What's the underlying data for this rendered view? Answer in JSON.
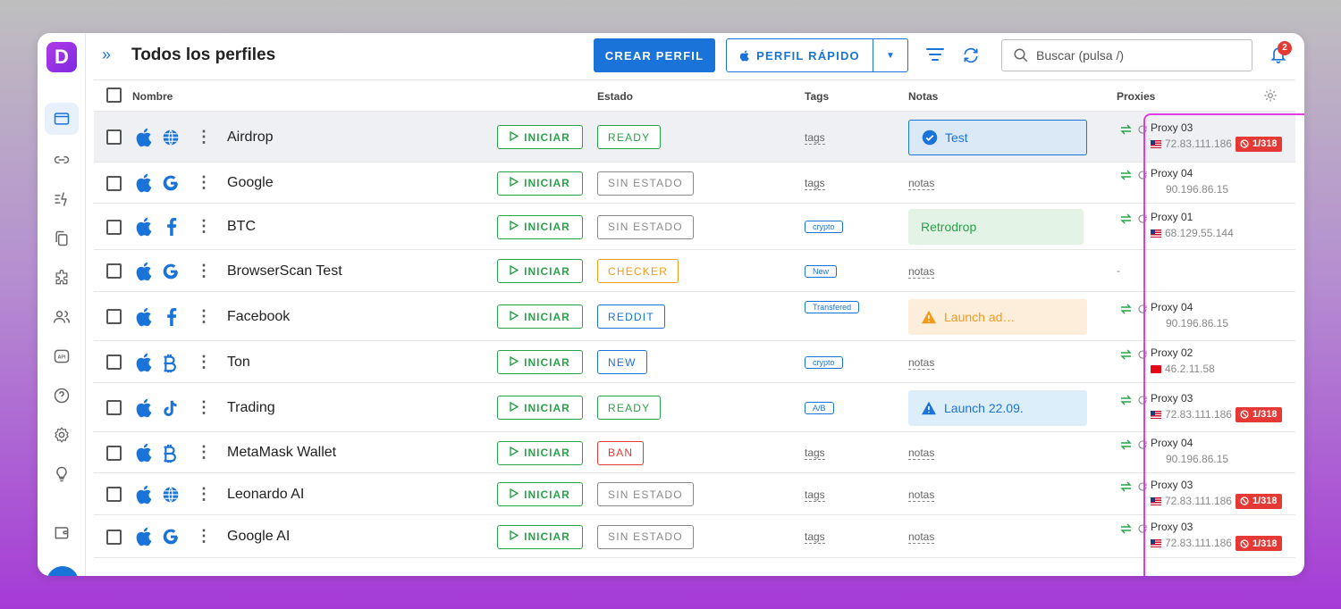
{
  "app": {
    "logo_letter": "D",
    "title": "Todos los perfiles"
  },
  "header": {
    "create_label": "CREAR PERFIL",
    "quick_label": "PERFIL RÁPIDO",
    "search_placeholder": "Buscar (pulsa /)",
    "notification_count": "2"
  },
  "table": {
    "columns": {
      "name": "Nombre",
      "status": "Estado",
      "tags": "Tags",
      "notes": "Notas",
      "proxies": "Proxies"
    },
    "start_label": "INICIAR"
  },
  "profiles": [
    {
      "name": "Airdrop",
      "os_icon": "apple-icon",
      "site_icon": "globe-icon",
      "status": "READY",
      "status_color": "#27a348",
      "tag": "tags",
      "tag_is_placeholder": true,
      "note": "Test",
      "note_kind": "info",
      "proxy": {
        "name": "Proxy 03",
        "country": "us",
        "ip": "72.83.111.186",
        "error": "1/318"
      }
    },
    {
      "name": "Google",
      "os_icon": "apple-icon",
      "site_icon": "google-icon",
      "status": "SIN ESTADO",
      "status_color": "#8a8a8a",
      "tag": "tags",
      "tag_is_placeholder": true,
      "note": "notas",
      "note_kind": "placeholder",
      "proxy": {
        "name": "Proxy 04",
        "country": "",
        "ip": "90.196.86.15",
        "error": ""
      }
    },
    {
      "name": "BTC",
      "os_icon": "apple-icon",
      "site_icon": "facebook-icon",
      "status": "SIN ESTADO",
      "status_color": "#8a8a8a",
      "tag": "crypto",
      "tag_is_placeholder": false,
      "note": "Retrodrop",
      "note_kind": "success",
      "proxy": {
        "name": "Proxy 01",
        "country": "us",
        "ip": "68.129.55.144",
        "error": ""
      }
    },
    {
      "name": "BrowserScan Test",
      "os_icon": "apple-icon",
      "site_icon": "google-icon",
      "status": "CHECKER",
      "status_color": "#f29a1a",
      "tag": "New",
      "tag_is_placeholder": false,
      "note": "notas",
      "note_kind": "placeholder",
      "proxy": {
        "name": "",
        "country": "",
        "ip": "",
        "error": "",
        "empty": "-"
      }
    },
    {
      "name": "Facebook",
      "os_icon": "apple-icon",
      "site_icon": "facebook-icon",
      "status": "REDDIT",
      "status_color": "#1a73d9",
      "tag": "Transfered",
      "tag_is_placeholder": false,
      "note": "Launch ad…",
      "note_kind": "warning",
      "proxy": {
        "name": "Proxy 04",
        "country": "",
        "ip": "90.196.86.15",
        "error": ""
      }
    },
    {
      "name": "Ton",
      "os_icon": "apple-icon",
      "site_icon": "bitcoin-icon",
      "status": "NEW",
      "status_color": "#1a73d9",
      "tag": "crypto",
      "tag_is_placeholder": false,
      "note": "notas",
      "note_kind": "placeholder",
      "proxy": {
        "name": "Proxy 02",
        "country": "tr",
        "ip": "46.2.11.58",
        "error": ""
      }
    },
    {
      "name": "Trading",
      "os_icon": "apple-icon",
      "site_icon": "tiktok-icon",
      "status": "READY",
      "status_color": "#27a348",
      "tag": "A/B",
      "tag_is_placeholder": false,
      "note": "Launch 22.09.",
      "note_kind": "alert",
      "proxy": {
        "name": "Proxy 03",
        "country": "us",
        "ip": "72.83.111.186",
        "error": "1/318"
      }
    },
    {
      "name": "MetaMask Wallet",
      "os_icon": "apple-icon",
      "site_icon": "bitcoin-icon",
      "status": "BAN",
      "status_color": "#e53935",
      "tag": "tags",
      "tag_is_placeholder": true,
      "note": "notas",
      "note_kind": "placeholder",
      "proxy": {
        "name": "Proxy 04",
        "country": "",
        "ip": "90.196.86.15",
        "error": ""
      }
    },
    {
      "name": "Leonardo AI",
      "os_icon": "apple-icon",
      "site_icon": "globe-icon",
      "status": "SIN ESTADO",
      "status_color": "#8a8a8a",
      "tag": "tags",
      "tag_is_placeholder": true,
      "note": "notas",
      "note_kind": "placeholder",
      "proxy": {
        "name": "Proxy 03",
        "country": "us",
        "ip": "72.83.111.186",
        "error": "1/318"
      }
    },
    {
      "name": "Google AI",
      "os_icon": "apple-icon",
      "site_icon": "google-icon",
      "status": "SIN ESTADO",
      "status_color": "#8a8a8a",
      "tag": "tags",
      "tag_is_placeholder": true,
      "note": "notas",
      "note_kind": "placeholder",
      "proxy": {
        "name": "Proxy 03",
        "country": "us",
        "ip": "72.83.111.186",
        "error": "1/318"
      }
    }
  ],
  "sidebar": {
    "items": [
      {
        "icon": "browser-profiles-icon",
        "active": true
      },
      {
        "icon": "link-icon",
        "active": false
      },
      {
        "icon": "automation-icon",
        "active": false
      },
      {
        "icon": "copy-icon",
        "active": false
      },
      {
        "icon": "extensions-icon",
        "active": false
      },
      {
        "icon": "team-icon",
        "active": false
      },
      {
        "icon": "api-icon",
        "active": false
      },
      {
        "icon": "help-icon",
        "active": false
      },
      {
        "icon": "settings-icon",
        "active": false
      },
      {
        "icon": "idea-icon",
        "active": false
      },
      {
        "icon": "wallet-icon",
        "active": false
      }
    ]
  },
  "colors": {
    "accent": "#1a73d9",
    "highlight": "#e23be6"
  }
}
